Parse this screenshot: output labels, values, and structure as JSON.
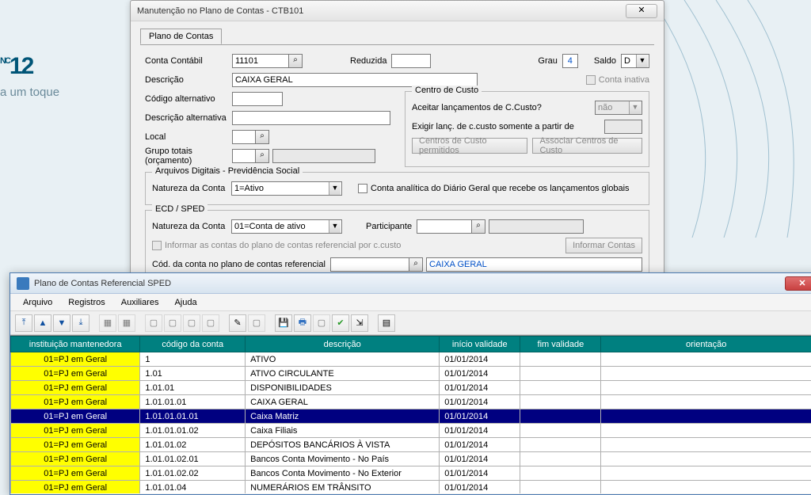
{
  "bg": {
    "logo": "NC",
    "logo_sub": "12",
    "tagline": "a um toque"
  },
  "win1": {
    "title": "Manutenção no Plano de Contas - CTB101",
    "tab": "Plano de Contas",
    "labels": {
      "conta": "Conta Contábil",
      "reduzida": "Reduzida",
      "grau": "Grau",
      "saldo": "Saldo",
      "descricao": "Descrição",
      "conta_inativa": "Conta inativa",
      "cod_alt": "Código alternativo",
      "desc_alt": "Descrição alternativa",
      "local": "Local",
      "grupo_totais": "Grupo totais (orçamento)",
      "natureza1": "Natureza da Conta",
      "analitica": "Conta analítica do Diário Geral que recebe os lançamentos globais",
      "natureza2": "Natureza da Conta",
      "participante": "Participante",
      "informar_custo": "Informar as contas do plano de contas referencial por c.custo",
      "informar_contas_btn": "Informar Contas",
      "cod_ref": "Cód. da conta no plano de contas referencial"
    },
    "values": {
      "conta": "11101",
      "grau": "4",
      "saldo": "D",
      "descricao": "CAIXA GERAL",
      "natureza1": "1=Ativo",
      "natureza2": "01=Conta de ativo",
      "cod_ref_desc": "CAIXA GERAL"
    },
    "group_arq": "Arquivos Digitais - Previdência Social",
    "group_ecd": "ECD / SPED",
    "cc": {
      "title": "Centro de Custo",
      "aceitar": "Aceitar lançamentos de C.Custo?",
      "aceitar_val": "não",
      "exigir": "Exigir lanç. de c.custo somente a partir de",
      "btn1": "Centros de Custo permitidos",
      "btn2": "Associar Centros de Custo"
    }
  },
  "win2": {
    "title": "Plano de Contas Referencial SPED",
    "menu": [
      "Arquivo",
      "Registros",
      "Auxiliares",
      "Ajuda"
    ],
    "cols": [
      "instituição mantenedora",
      "código da conta",
      "descrição",
      "início validade",
      "fim validade",
      "orientação"
    ],
    "rows": [
      {
        "inst": "01=PJ em Geral",
        "cod": "1",
        "desc": "ATIVO",
        "ini": "01/01/2014",
        "fim": "",
        "ori": "",
        "sel": false
      },
      {
        "inst": "01=PJ em Geral",
        "cod": "1.01",
        "desc": "ATIVO CIRCULANTE",
        "ini": "01/01/2014",
        "fim": "",
        "ori": "",
        "sel": false
      },
      {
        "inst": "01=PJ em Geral",
        "cod": "1.01.01",
        "desc": "DISPONIBILIDADES",
        "ini": "01/01/2014",
        "fim": "",
        "ori": "",
        "sel": false
      },
      {
        "inst": "01=PJ em Geral",
        "cod": "1.01.01.01",
        "desc": "CAIXA GERAL",
        "ini": "01/01/2014",
        "fim": "",
        "ori": "",
        "sel": false
      },
      {
        "inst": "01=PJ em Geral",
        "cod": "1.01.01.01.01",
        "desc": "Caixa Matriz",
        "ini": "01/01/2014",
        "fim": "",
        "ori": "",
        "sel": true
      },
      {
        "inst": "01=PJ em Geral",
        "cod": "1.01.01.01.02",
        "desc": "Caixa Filiais",
        "ini": "01/01/2014",
        "fim": "",
        "ori": "",
        "sel": false
      },
      {
        "inst": "01=PJ em Geral",
        "cod": "1.01.01.02",
        "desc": "DEPÓSITOS BANCÁRIOS À VISTA",
        "ini": "01/01/2014",
        "fim": "",
        "ori": "",
        "sel": false
      },
      {
        "inst": "01=PJ em Geral",
        "cod": "1.01.01.02.01",
        "desc": "Bancos Conta Movimento - No País",
        "ini": "01/01/2014",
        "fim": "",
        "ori": "",
        "sel": false
      },
      {
        "inst": "01=PJ em Geral",
        "cod": "1.01.01.02.02",
        "desc": "Bancos Conta Movimento - No Exterior",
        "ini": "01/01/2014",
        "fim": "",
        "ori": "",
        "sel": false
      },
      {
        "inst": "01=PJ em Geral",
        "cod": "1.01.01.04",
        "desc": "NUMERÁRIOS EM TRÂNSITO",
        "ini": "01/01/2014",
        "fim": "",
        "ori": "",
        "sel": false
      }
    ]
  }
}
